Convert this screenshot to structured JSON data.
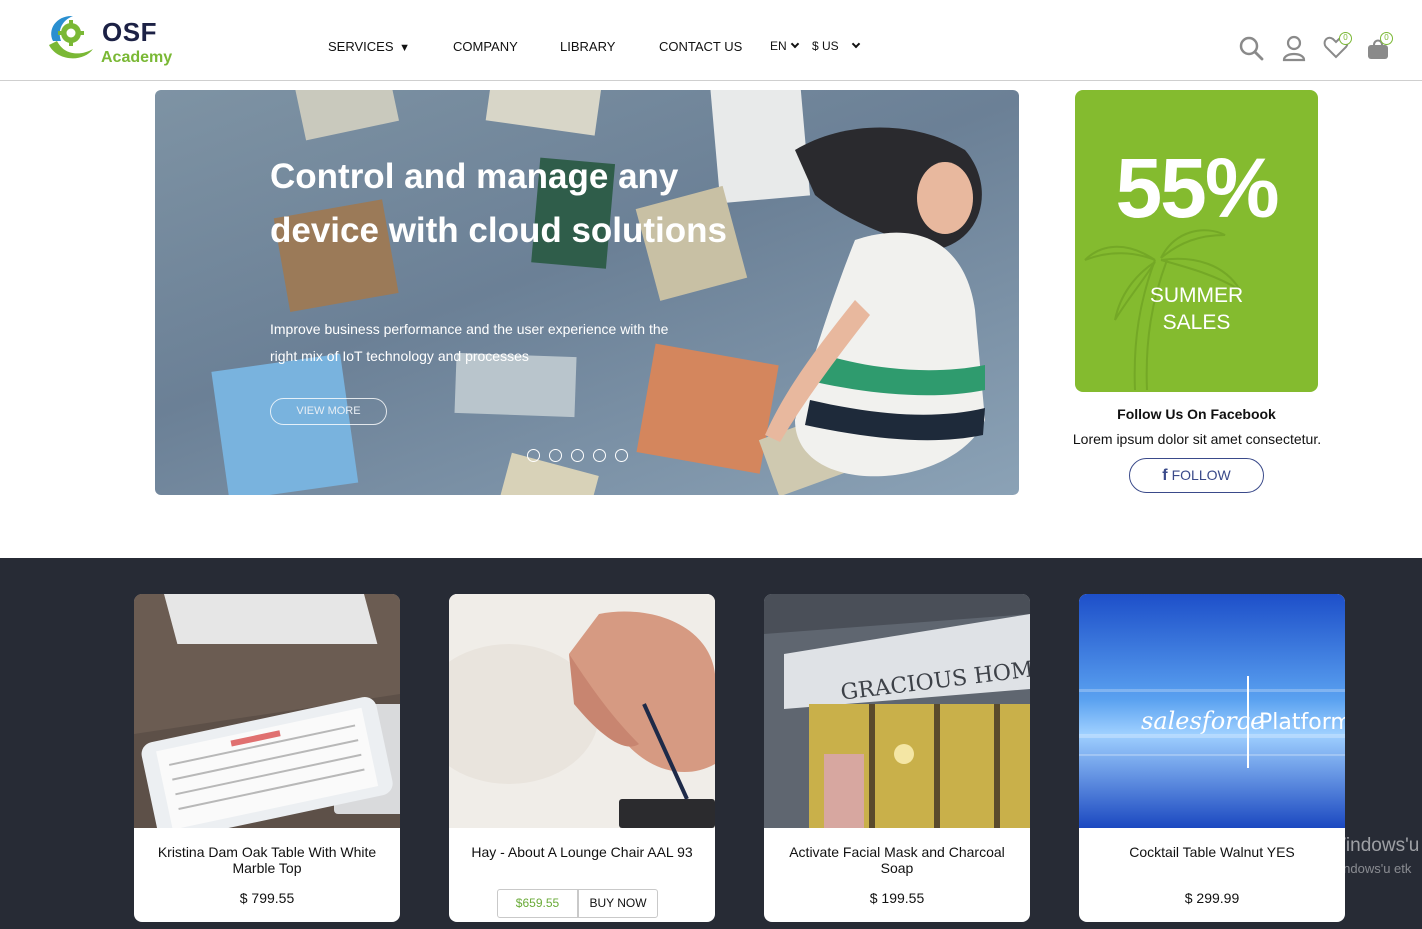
{
  "header": {
    "logo_title": "OSF",
    "logo_subtitle": "Academy",
    "nav": [
      {
        "label": "SERVICES",
        "caret": "▼"
      },
      {
        "label": "COMPANY"
      },
      {
        "label": "LIBRARY"
      },
      {
        "label": "CONTACT US"
      }
    ],
    "language": "EN",
    "currency": "$ US",
    "wishlist_count": "0",
    "cart_count": "0"
  },
  "hero": {
    "title": "Control and manage any device with cloud solutions",
    "text": "Improve business performance and the user experience with the right mix of IoT technology and processes",
    "button_label": "VIEW MORE",
    "slide_count": 5
  },
  "promo": {
    "percent": "55%",
    "line1": "SUMMER",
    "line2": "SALES"
  },
  "facebook": {
    "title": "Follow Us On Facebook",
    "text": "Lorem ipsum dolor sit amet consectetur.",
    "button_icon": "f",
    "button_label": "FOLLOW"
  },
  "products": [
    {
      "name": "Kristina Dam Oak Table With White Marble Top",
      "price": "$ 799.55",
      "image": "tablet-calendar-image"
    },
    {
      "name": "Hay - About A Lounge Chair AAL 93",
      "price": "$659.55",
      "buy_label": "BUY NOW",
      "image": "hand-stylus-image"
    },
    {
      "name": "Activate Facial Mask and Charcoal Soap",
      "price": "$ 199.55",
      "image": "storefront-image",
      "image_text": "GRACIOUS HOME"
    },
    {
      "name": "Cocktail Table Walnut YES",
      "price": "$ 299.99",
      "image": "salesforce-platform-image",
      "image_text_1": "salesforce",
      "image_text_2": "Platform"
    }
  ],
  "watermark": {
    "line1": "Windows'u",
    "line2": "Windows'u etk"
  },
  "colors": {
    "brand_navy": "#1c2145",
    "brand_green": "#7ab835",
    "promo_green": "#84bb2f",
    "dark_band": "#272b35",
    "facebook_blue": "#3a4a8a"
  }
}
